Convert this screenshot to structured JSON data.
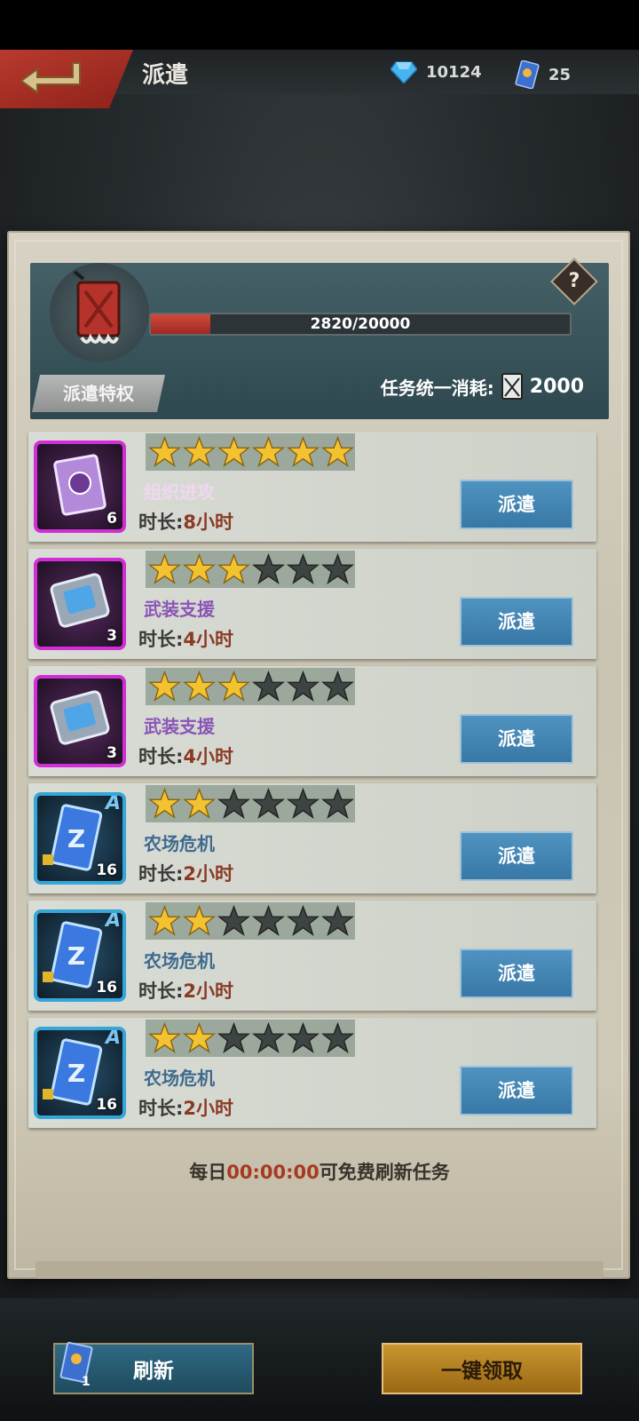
{
  "header": {
    "title": "派遣",
    "diamonds": "10124",
    "tickets": "25"
  },
  "panel": {
    "progress_text": "2820/20000",
    "progress_fraction": 0.141,
    "privilege_label": "派遣特权",
    "help_symbol": "?",
    "cost_label": "任务统一消耗:",
    "cost_value": "2000"
  },
  "tasks": [
    {
      "stars": 6,
      "name": "组织进攻",
      "duration_label": "时长:",
      "duration_value": "8小时",
      "count": "6",
      "button": "派遣"
    },
    {
      "stars": 3,
      "name": "武装支援",
      "duration_label": "时长:",
      "duration_value": "4小时",
      "count": "3",
      "button": "派遣"
    },
    {
      "stars": 3,
      "name": "武装支援",
      "duration_label": "时长:",
      "duration_value": "4小时",
      "count": "3",
      "button": "派遣"
    },
    {
      "stars": 2,
      "name": "农场危机",
      "duration_label": "时长:",
      "duration_value": "2小时",
      "count": "16",
      "grade": "A",
      "button": "派遣"
    },
    {
      "stars": 2,
      "name": "农场危机",
      "duration_label": "时长:",
      "duration_value": "2小时",
      "count": "16",
      "grade": "A",
      "button": "派遣"
    },
    {
      "stars": 2,
      "name": "农场危机",
      "duration_label": "时长:",
      "duration_value": "2小时",
      "count": "16",
      "grade": "A",
      "button": "派遣"
    }
  ],
  "footer": {
    "daily_prefix": "每日",
    "daily_time": "00:00:00",
    "daily_suffix": "可免费刷新任务"
  },
  "bottom": {
    "refresh_label": "刷新",
    "refresh_ticket_count": "1",
    "claim_all_label": "一键领取"
  },
  "colors": {
    "dispatch_button": "#4f93c0",
    "claim_button": "#c9962f",
    "back_button": "#b83a2e"
  }
}
